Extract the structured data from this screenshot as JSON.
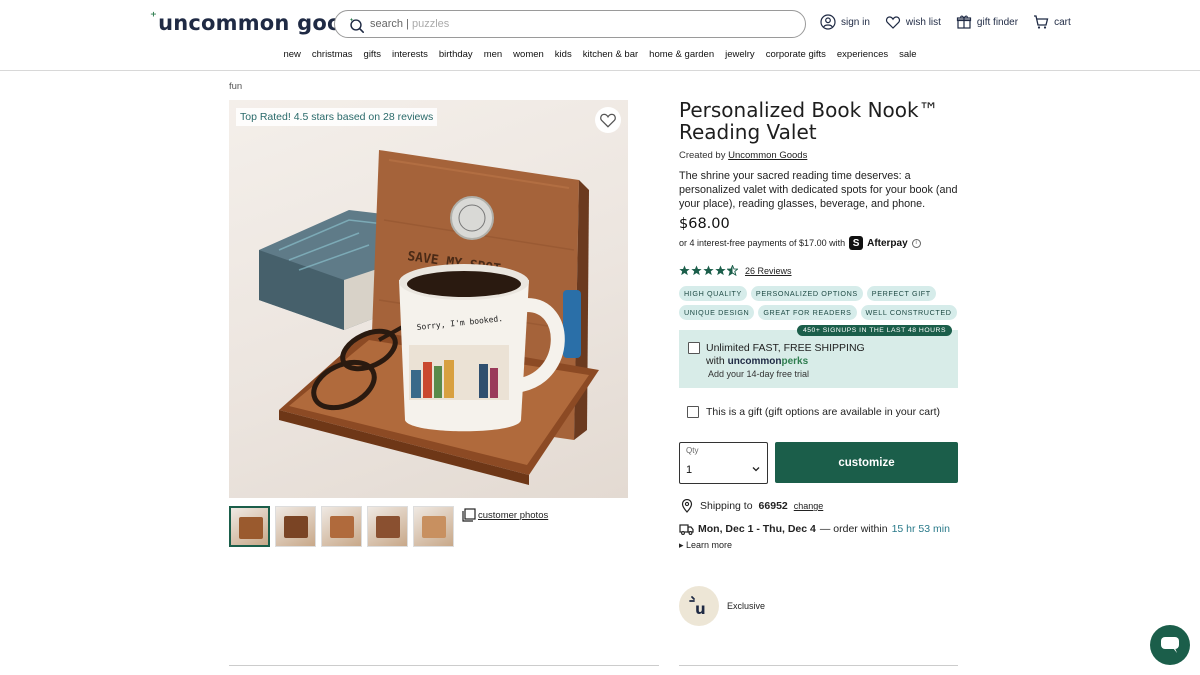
{
  "brand": {
    "logo_text": "uncommon goods"
  },
  "search": {
    "prefix": "search |",
    "suggestion": "puzzles"
  },
  "header_links": [
    {
      "label": "sign in",
      "icon": "user-icon"
    },
    {
      "label": "wish list",
      "icon": "heart-icon"
    },
    {
      "label": "gift finder",
      "icon": "gift-icon"
    },
    {
      "label": "cart",
      "icon": "cart-icon"
    }
  ],
  "nav": [
    "new",
    "christmas",
    "gifts",
    "interests",
    "birthday",
    "men",
    "women",
    "kids",
    "kitchen & bar",
    "home & garden",
    "jewelry",
    "corporate gifts",
    "experiences",
    "sale"
  ],
  "breadcrumb": "fun",
  "image": {
    "top_rated": "Top Rated! 4.5 stars based on 28 reviews",
    "engraving": "SAVE MY SPOT",
    "mug_text": "Sorry, I'm booked.",
    "customer_photos": "customer photos"
  },
  "product": {
    "title": "Personalized Book Nook™ Reading Valet",
    "created_by_prefix": "Created by",
    "creator": "Uncommon Goods",
    "description": "The shrine your sacred reading time deserves: a personalized valet with dedicated spots for your book (and your place), reading glasses, beverage, and phone.",
    "price": "$68.00",
    "afterpay_text": "or 4 interest-free payments of $17.00 with",
    "afterpay_brand": "Afterpay",
    "rating": 4.5,
    "reviews": "26 Reviews",
    "badges": [
      "HIGH QUALITY",
      "PERSONALIZED OPTIONS",
      "PERFECT GIFT",
      "UNIQUE DESIGN",
      "GREAT FOR READERS",
      "WELL CONSTRUCTED"
    ]
  },
  "perks": {
    "banner": "450+ SIGNUPS IN THE LAST 48 HOURS",
    "line1": "Unlimited FAST, FREE SHIPPING",
    "with": "with",
    "brand_a": "uncommon",
    "brand_b": "perks",
    "trial": "Add your 14-day free trial"
  },
  "gift_option": "This is a gift (gift options are available in your cart)",
  "qty": {
    "label": "Qty",
    "value": "1"
  },
  "customize_label": "customize",
  "shipping": {
    "prefix": "Shipping to",
    "zip": "66952",
    "change": "change"
  },
  "delivery": {
    "dates": "Mon, Dec 1 - Thu, Dec 4",
    "mid": "— order within",
    "timer": "15 hr 53 min",
    "learn_more": "Learn more"
  },
  "exclusive": {
    "badge": "u",
    "label": "Exclusive"
  },
  "colors": {
    "brand_green": "#1b5e4a",
    "badge_bg": "#d6ecea",
    "perks_bg": "#d8ece8"
  }
}
